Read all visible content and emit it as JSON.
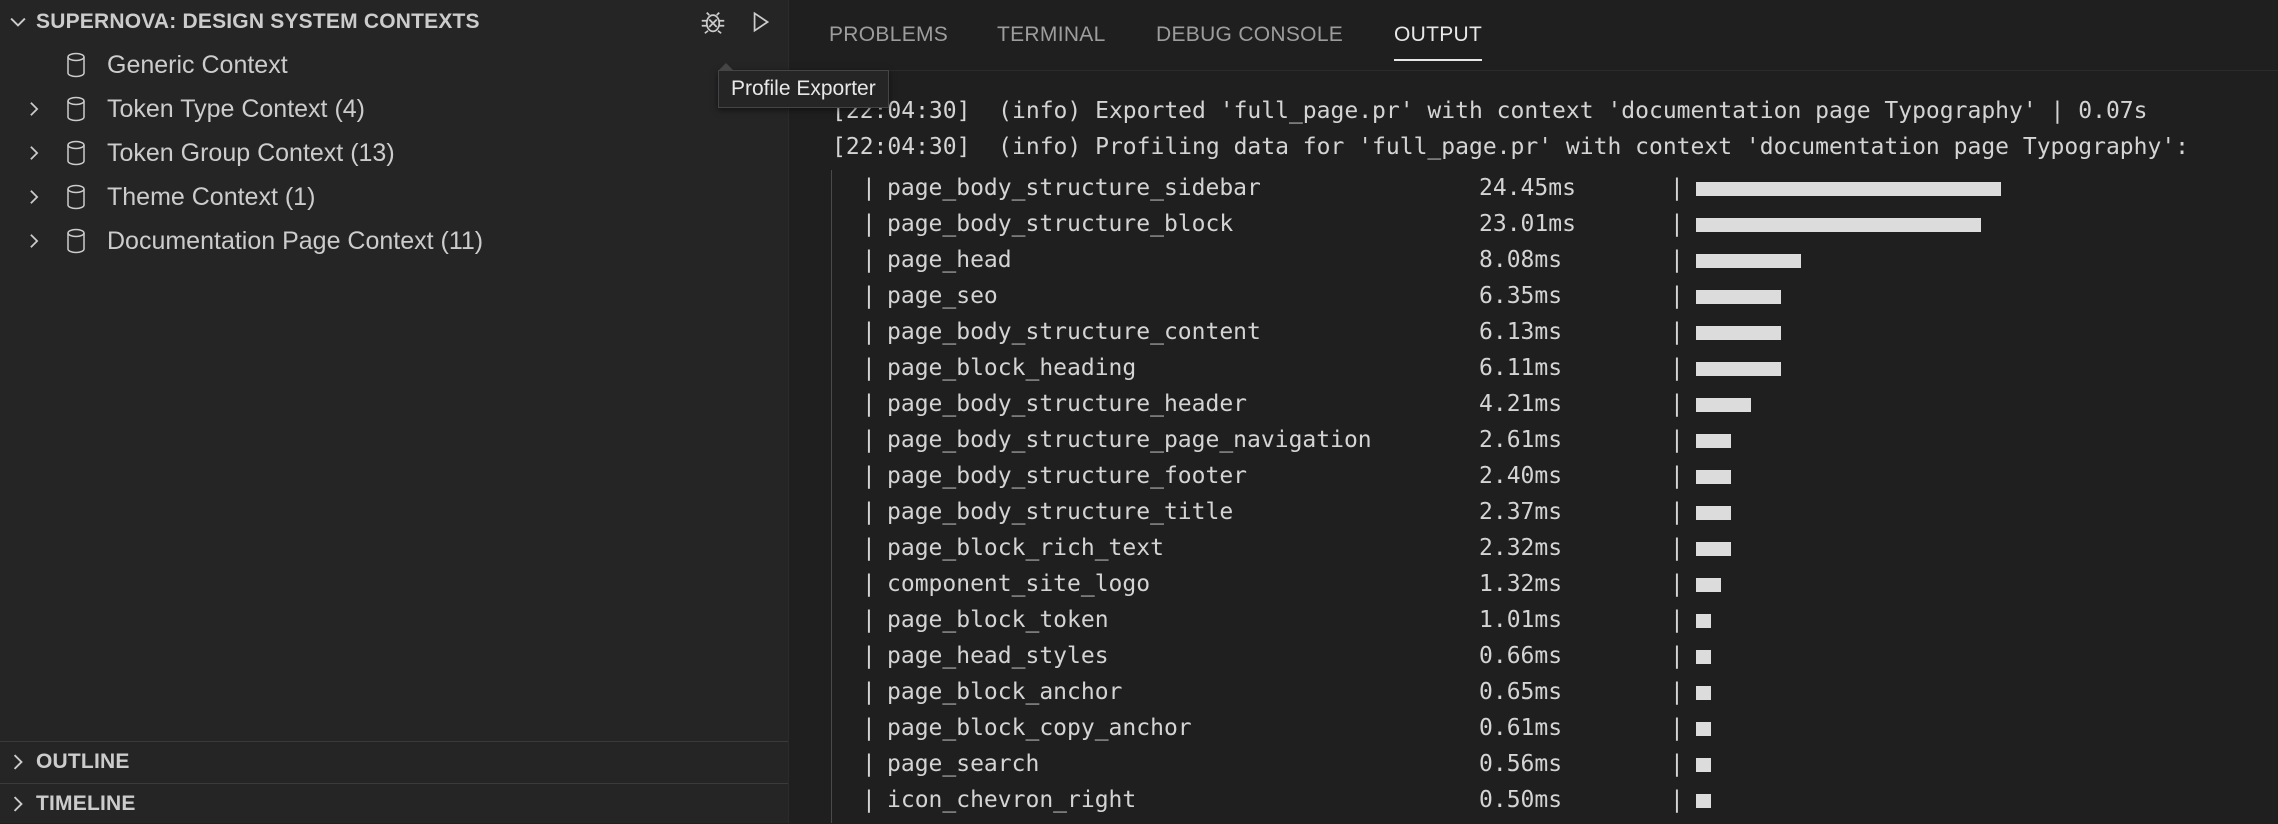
{
  "sidebar": {
    "section_title": "SUPERNOVA: DESIGN SYSTEM CONTEXTS",
    "items": [
      {
        "label": "Generic Context",
        "expandable": false
      },
      {
        "label": "Token Type Context (4)",
        "expandable": true
      },
      {
        "label": "Token Group Context (13)",
        "expandable": true
      },
      {
        "label": "Theme Context (1)",
        "expandable": true
      },
      {
        "label": "Documentation Page Context (11)",
        "expandable": true
      }
    ],
    "outline_label": "OUTLINE",
    "timeline_label": "TIMELINE",
    "tooltip": "Profile Exporter",
    "icons": {
      "bug": "bug-icon",
      "run": "play-icon",
      "item": "database-icon"
    }
  },
  "panel": {
    "tabs": [
      {
        "label": "PROBLEMS",
        "active": false
      },
      {
        "label": "TERMINAL",
        "active": false
      },
      {
        "label": "DEBUG CONSOLE",
        "active": false
      },
      {
        "label": "OUTPUT",
        "active": true
      }
    ],
    "log_lines": [
      "[22:04:30]  (info) Exported 'full_page.pr' with context 'documentation page Typography' | 0.07s",
      "[22:04:30]  (info) Profiling data for 'full_page.pr' with context 'documentation page Typography':"
    ],
    "profile": [
      {
        "name": "page_body_structure_sidebar",
        "time": "24.45ms",
        "bar_units": 30
      },
      {
        "name": "page_body_structure_block",
        "time": "23.01ms",
        "bar_units": 28
      },
      {
        "name": "page_head",
        "time": "8.08ms",
        "bar_units": 10
      },
      {
        "name": "page_seo",
        "time": "6.35ms",
        "bar_units": 8
      },
      {
        "name": "page_body_structure_content",
        "time": "6.13ms",
        "bar_units": 8
      },
      {
        "name": "page_block_heading",
        "time": "6.11ms",
        "bar_units": 8
      },
      {
        "name": "page_body_structure_header",
        "time": "4.21ms",
        "bar_units": 5
      },
      {
        "name": "page_body_structure_page_navigation",
        "time": "2.61ms",
        "bar_units": 3
      },
      {
        "name": "page_body_structure_footer",
        "time": "2.40ms",
        "bar_units": 3
      },
      {
        "name": "page_body_structure_title",
        "time": "2.37ms",
        "bar_units": 3
      },
      {
        "name": "page_block_rich_text",
        "time": "2.32ms",
        "bar_units": 3
      },
      {
        "name": "component_site_logo",
        "time": "1.32ms",
        "bar_units": 2
      },
      {
        "name": "page_block_token",
        "time": "1.01ms",
        "bar_units": 1
      },
      {
        "name": "page_head_styles",
        "time": "0.66ms",
        "bar_units": 1
      },
      {
        "name": "page_block_anchor",
        "time": "0.65ms",
        "bar_units": 1
      },
      {
        "name": "page_block_copy_anchor",
        "time": "0.61ms",
        "bar_units": 1
      },
      {
        "name": "page_search",
        "time": "0.56ms",
        "bar_units": 1
      },
      {
        "name": "icon_chevron_right",
        "time": "0.50ms",
        "bar_units": 1
      }
    ]
  }
}
